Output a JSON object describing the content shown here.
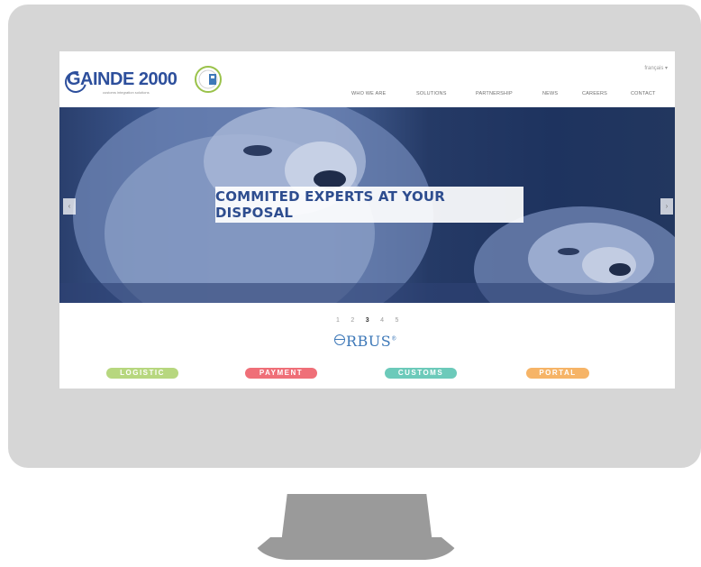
{
  "brand": {
    "name": "GAINDE 2000",
    "tagline": "customs integration solutions"
  },
  "header": {
    "language": "français ▾",
    "nav": [
      "WHO WE ARE",
      "SOLUTIONS",
      "PARTNERSHIP",
      "NEWS",
      "CAREERS",
      "CONTACT"
    ]
  },
  "hero": {
    "caption": "COMMITED EXPERTS AT YOUR DISPOSAL",
    "prev_icon": "chevron-left-icon",
    "next_icon": "chevron-right-icon",
    "prev_label": "‹",
    "next_label": "›"
  },
  "pager": {
    "pages": [
      "1",
      "2",
      "3",
      "4",
      "5"
    ],
    "active": "3"
  },
  "product": {
    "name": "RBUS",
    "mark": "®"
  },
  "pills": [
    {
      "label": "LOGISTIC",
      "color": "#b7d77f"
    },
    {
      "label": "PAYMENT",
      "color": "#ef6f78"
    },
    {
      "label": "CUSTOMS",
      "color": "#6ccaba"
    },
    {
      "label": "PORTAL",
      "color": "#f6b467"
    }
  ],
  "colors": {
    "monitor": "#d6d6d6",
    "stand": "#9a9a9a",
    "brand_blue": "#2d4f9c"
  }
}
